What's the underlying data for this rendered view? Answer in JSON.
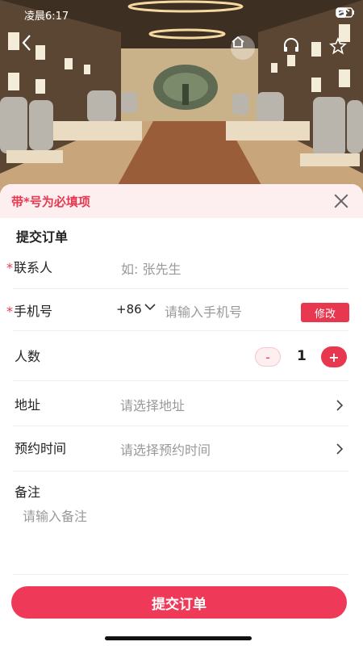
{
  "status": {
    "time": "凌晨6:17"
  },
  "notice": {
    "text": "带*号为必填项"
  },
  "form": {
    "title": "提交订单",
    "contact": {
      "required_mark": "*",
      "label": "联系人",
      "placeholder": "如: 张先生"
    },
    "phone": {
      "required_mark": "*",
      "label": "手机号",
      "country_code": "+86",
      "placeholder": "请输入手机号",
      "edit_label": "修改"
    },
    "people": {
      "label": "人数",
      "minus": "-",
      "quantity": "1",
      "plus": "+"
    },
    "address": {
      "label": "地址",
      "placeholder": "请选择地址"
    },
    "time": {
      "label": "预约时间",
      "placeholder": "请选择预约时间"
    },
    "remark": {
      "label": "备注",
      "placeholder": "请输入备注"
    }
  },
  "submit": {
    "label": "提交订单"
  },
  "colors": {
    "accent": "#e8384f",
    "notice_bg": "#fdeef0"
  },
  "icons": [
    "back-arrow-icon",
    "home-icon",
    "headset-icon",
    "star-icon",
    "close-icon",
    "chevron-down-icon",
    "chevron-right-icon"
  ]
}
